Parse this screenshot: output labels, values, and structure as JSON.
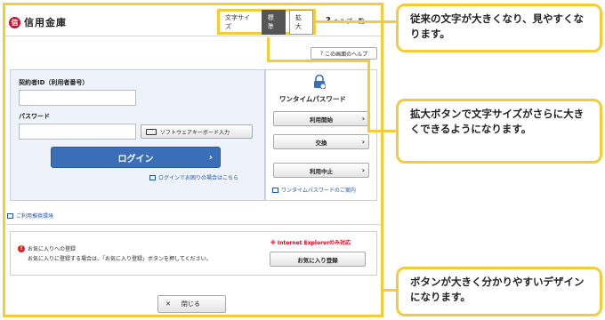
{
  "header": {
    "logo_mark": "信",
    "logo_text": "信用金庫",
    "font_size_label": "文字サイズ",
    "font_standard": "標準",
    "font_large": "拡大",
    "help_all": "ヘルプ一覧",
    "help_page": "この画面のヘルプ"
  },
  "login": {
    "contract_id_label": "契約者ID（利用者番号）",
    "password_label": "パスワード",
    "software_keyboard": "ソフトウェアキーボード入力",
    "login_button": "ログイン",
    "forgot_link": "ログインでお困りの場合はこちら"
  },
  "onetime": {
    "title": "ワンタイムパスワード",
    "buttons": [
      "利用開始",
      "交換",
      "利用中止"
    ],
    "guide_link": "ワンタイムパスワードのご案内"
  },
  "env_link": "ご利用推奨環境",
  "favorites": {
    "title": "お気に入りへの登録",
    "description": "お気に入りに登録する場合は、「お気に入り登録」ボタンを押してください。",
    "ie_note": "※ Internet Explorerのみ対応",
    "button": "お気に入り登録"
  },
  "close_button": "閉じる",
  "callouts": [
    "従来の文字が大きくなり、見やすくなります。",
    "拡大ボタンで文字サイズがさらに大きくできるようになります。",
    "ボタンが大きく分かりやすいデザインになります。"
  ],
  "colors": {
    "highlight": "#f2cc3a",
    "login_blue": "#3a6fb8",
    "brand_red": "#c8102e"
  }
}
